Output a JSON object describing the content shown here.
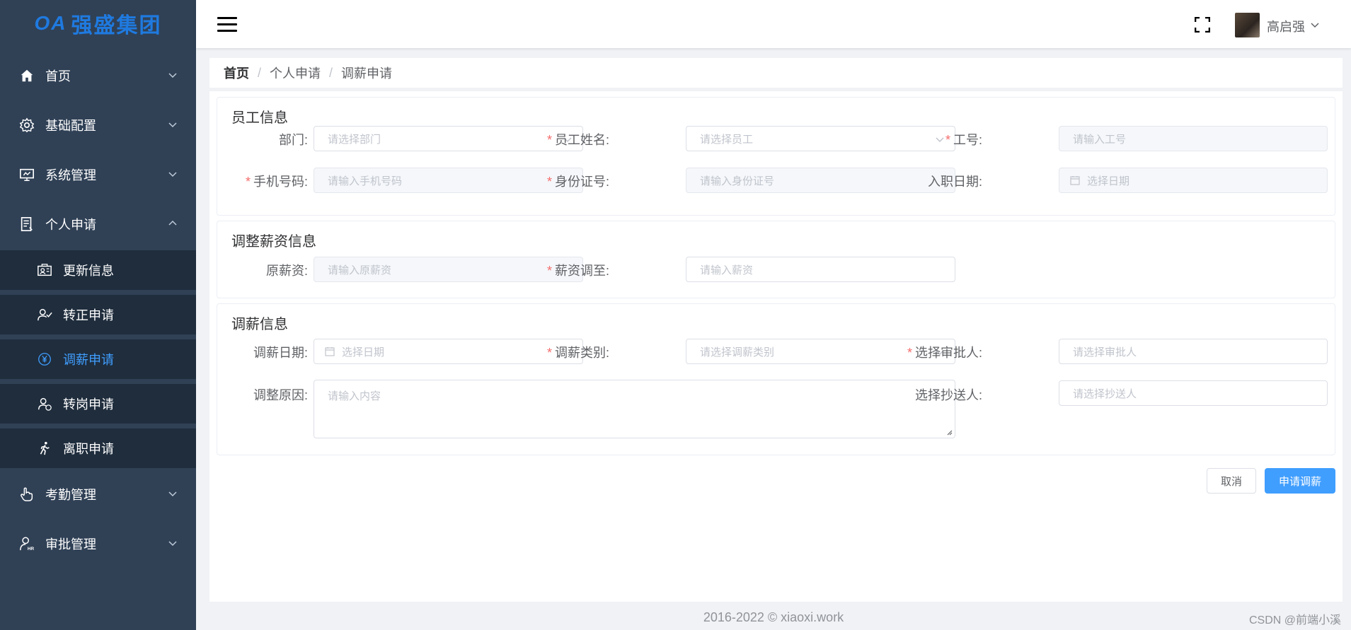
{
  "app": {
    "logo_oa": "OA",
    "logo_text": "强盛集团"
  },
  "sidebar": {
    "items": [
      {
        "label": "首页",
        "icon": "home-icon"
      },
      {
        "label": "基础配置",
        "icon": "gear-icon"
      },
      {
        "label": "系统管理",
        "icon": "monitor-icon"
      },
      {
        "label": "个人申请",
        "icon": "document-icon"
      },
      {
        "label": "考勤管理",
        "icon": "hand-icon"
      },
      {
        "label": "审批管理",
        "icon": "user-hr-icon"
      }
    ],
    "sub_items": [
      {
        "label": "更新信息",
        "icon": "id-card-icon"
      },
      {
        "label": "转正申请",
        "icon": "user-check-icon"
      },
      {
        "label": "调薪申请",
        "icon": "yen-icon"
      },
      {
        "label": "转岗申请",
        "icon": "user-swap-icon"
      },
      {
        "label": "离职申请",
        "icon": "walk-icon"
      }
    ],
    "active_color": "#409eff"
  },
  "header": {
    "username": "高启强"
  },
  "breadcrumb": {
    "home": "首页",
    "level2": "个人申请",
    "level3": "调薪申请",
    "separator": "/"
  },
  "employee_info": {
    "title": "员工信息",
    "department": {
      "label": "部门:",
      "placeholder": "请选择部门"
    },
    "name": {
      "label": "员工姓名:",
      "placeholder": "请选择员工"
    },
    "job_no": {
      "label": "工号:",
      "placeholder": "请输入工号"
    },
    "phone": {
      "label": "手机号码:",
      "placeholder": "请输入手机号码"
    },
    "id_no": {
      "label": "身份证号:",
      "placeholder": "请输入身份证号"
    },
    "entry_date": {
      "label": "入职日期:",
      "placeholder": "选择日期"
    }
  },
  "salary_info": {
    "title": "调整薪资信息",
    "original": {
      "label": "原薪资:",
      "placeholder": "请输入原薪资"
    },
    "adjust_to": {
      "label": "薪资调至:",
      "placeholder": "请输入薪资"
    }
  },
  "adjust_info": {
    "title": "调薪信息",
    "date": {
      "label": "调薪日期:",
      "placeholder": "选择日期"
    },
    "category": {
      "label": "调薪类别:",
      "placeholder": "请选择调薪类别"
    },
    "approver": {
      "label": "选择审批人:",
      "placeholder": "请选择审批人"
    },
    "reason": {
      "label": "调整原因:",
      "placeholder": "请输入内容"
    },
    "cc": {
      "label": "选择抄送人:",
      "placeholder": "请选择抄送人"
    }
  },
  "required_mark": "*",
  "buttons": {
    "cancel": "取消",
    "submit": "申请调薪"
  },
  "footer": {
    "copyright": "2016-2022 © xiaoxi.work",
    "watermark": "CSDN @前端小溪"
  }
}
